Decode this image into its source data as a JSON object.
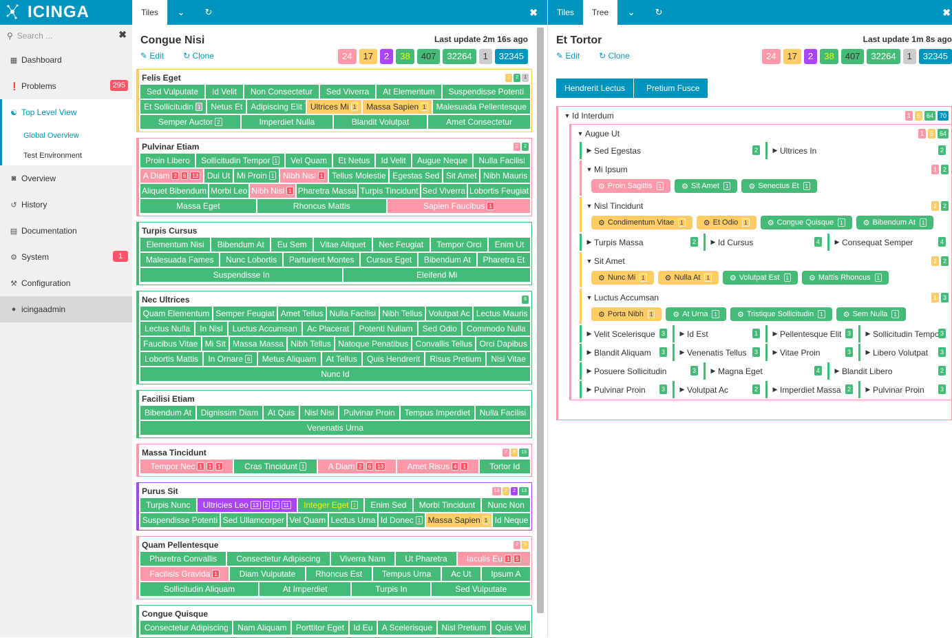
{
  "brand": "icinga",
  "search_placeholder": "Search ...",
  "nav": [
    {
      "label": "Dashboard",
      "icon": "dashboard-icon"
    },
    {
      "label": "Problems",
      "icon": "problems-icon",
      "badge": "295"
    },
    {
      "label": "Top Level View",
      "icon": "sitemap-icon"
    },
    {
      "label": "Global Overview"
    },
    {
      "label": "Test Environment"
    },
    {
      "label": "Overview",
      "icon": "binoculars-icon"
    },
    {
      "label": "History",
      "icon": "history-icon"
    },
    {
      "label": "Documentation",
      "icon": "book-icon"
    },
    {
      "label": "System",
      "icon": "services-icon",
      "badge": "1"
    },
    {
      "label": "Configuration",
      "icon": "wrench-icon"
    },
    {
      "label": "icingaadmin",
      "icon": "user-icon"
    }
  ],
  "left": {
    "tabs": [
      "Tiles"
    ],
    "title": "Congue Nisi",
    "last_update": "Last update 2m 16s ago",
    "edit": "Edit",
    "clone": "Clone",
    "counts": [
      "24",
      "17",
      "2",
      "38",
      "407",
      "32264",
      "1",
      "32345"
    ]
  },
  "right": {
    "tabs": [
      "Tiles",
      "Tree"
    ],
    "title": "Et Tortor",
    "last_update": "Last update 1m 8s ago",
    "edit": "Edit",
    "clone": "Clone",
    "counts": [
      "24",
      "17",
      "2",
      "38",
      "407",
      "32264",
      "1",
      "32345"
    ],
    "crumbs": [
      "Hendrerit Lectus",
      "Pretium Fusce"
    ]
  },
  "colors": {
    "ok": "#44bb77",
    "critical": "#ff99aa",
    "warning": "#ffcc66",
    "unknown": "#aa44ff",
    "accent": "#0095bf"
  },
  "groups": [
    {
      "title": "Felis Eget",
      "counts": [
        "2",
        "2",
        "1"
      ],
      "rows": [
        [
          "Sed Vulputate",
          "Id Velit",
          "Non Consectetur",
          "Sed Viverra",
          "At Elementum",
          "Suspendisse Potenti"
        ],
        [
          "Et Sollicitudin",
          "Netus Et",
          "Adipiscing Elit",
          "Ultrices Mi",
          "Massa Sapien",
          "Malesuada Pellentesque"
        ],
        [
          "Semper Auctor",
          "Imperdiet Nulla",
          "Blandit Volutpat",
          "Amet Consectetur"
        ]
      ]
    },
    {
      "title": "Pulvinar Etiam",
      "counts": [
        "2",
        "2"
      ],
      "rows": [
        [
          "Proin Libero",
          "Sollicitudin Tempor",
          "Vel Quam",
          "Et Netus",
          "Id Velit",
          "Augue Neque",
          "Nulla Facilisi"
        ],
        [
          "A Diam",
          "Dui Ut",
          "Mi Proin",
          "Nibh Nisl",
          "Tellus Molestie",
          "Egestas Sed",
          "Sit Amet",
          "Nibh Mauris"
        ],
        [
          "Aliquet Bibendum",
          "Morbi Leo",
          "Nibh Nisl",
          "Pharetra Massa",
          "Turpis Tincidunt",
          "Sed Viverra",
          "Lobortis Feugiat"
        ],
        [
          "Massa Eget",
          "Rhoncus Mattis",
          "Sapien Faucibus"
        ]
      ]
    },
    {
      "title": "Turpis Cursus",
      "counts": [],
      "rows": [
        [
          "Elementum Nisi",
          "Bibendum At",
          "Eu Sem",
          "Vitae Aliquet",
          "Nec Feugiat",
          "Tempor Orci",
          "Enim Ut"
        ],
        [
          "Malesuada Fames",
          "Nunc Lobortis",
          "Parturient Montes",
          "Cursus Eget",
          "Bibendum At",
          "Pharetra Et"
        ],
        [
          "Suspendisse In",
          "Eleifend Mi"
        ]
      ]
    },
    {
      "title": "Nec Ultrices",
      "counts": [
        "6"
      ],
      "rows": [
        [
          "Quam Elementum",
          "Semper Feugiat",
          "Amet Tellus",
          "Nulla Facilisi",
          "Nibh Tellus",
          "Volutpat Ac",
          "Lectus Mauris"
        ],
        [
          "Lectus Nulla",
          "In Nisl",
          "Luctus Accumsan",
          "Ac Placerat",
          "Potenti Nullam",
          "Sed Odio",
          "Commodo Nulla"
        ],
        [
          "Faucibus Vitae",
          "Mi Sit",
          "Massa Massa",
          "Nibh Tellus",
          "Natoque Penatibus",
          "Convallis Tellus",
          "Orci Dapibus"
        ],
        [
          "Lobortis Mattis",
          "In Ornare",
          "Metus Aliquam",
          "At Tellus",
          "Quis Hendrerit",
          "Risus Pretium",
          "Nisi Vitae"
        ],
        [
          "Nunc Id"
        ]
      ]
    },
    {
      "title": "Facilisi Etiam",
      "counts": [],
      "rows": [
        [
          "Bibendum At",
          "Dignissim Diam",
          "At Quis",
          "Nisl Nisi",
          "Pulvinar Proin",
          "Tempus Imperdiet",
          "Nulla Facilisi"
        ],
        [
          "Venenatis Urna"
        ]
      ]
    },
    {
      "title": "Massa Tincidunt",
      "counts": [
        "7",
        "8",
        "15"
      ],
      "rows": [
        [
          "Tempor Nec",
          "Cras Tincidunt",
          "A Diam",
          "Amet Risus",
          "Tortor Id"
        ]
      ]
    },
    {
      "title": "Purus Sit",
      "counts": [
        "13",
        "2",
        "2",
        "13"
      ],
      "rows": [
        [
          "Turpis Nunc",
          "Ultricies Leo",
          "Integer Eget",
          "Enim Sed",
          "Morbi Tincidunt",
          "Nunc Non"
        ],
        [
          "Suspendisse Potenti",
          "Sed Ullamcorper",
          "Vel Quam",
          "Lectus Urna",
          "Id Donec",
          "Massa Sapien",
          "Id Neque"
        ]
      ]
    },
    {
      "title": "Quam Pellentesque",
      "counts": [
        "2",
        "5"
      ],
      "rows": [
        [
          "Pharetra Convallis",
          "Consectetur Adipiscing",
          "Viverra Nam",
          "Ut Pharetra",
          "Iaculis Eu"
        ],
        [
          "Facilisis Gravida",
          "Diam Vulputate",
          "Rhoncus Est",
          "Tempus Urna",
          "Ac Ut",
          "Ipsum A"
        ],
        [
          "Sollicitudin Aliquam",
          "At Imperdiet",
          "Turpis In",
          "Sed Vulputate"
        ]
      ]
    },
    {
      "title": "Congue Quisque",
      "counts": [],
      "rows": [
        [
          "Consectetur Adipiscing",
          "Nam Aliquam",
          "Porttitor Eget",
          "Id Eu",
          "A Scelerisque",
          "Nisl Pretium",
          "Quis Vel"
        ]
      ]
    }
  ],
  "tree": {
    "root": {
      "label": "Id Interdum",
      "counts": [
        "1",
        "5",
        "64",
        "70"
      ]
    },
    "l1": {
      "label": "Augue Ut",
      "counts": [
        "1",
        "5",
        "64"
      ]
    },
    "nodes": [
      {
        "label": "Sed Egestas",
        "count": "2"
      },
      {
        "label": "Ultrices In",
        "count": "2"
      },
      {
        "label": "Mi Ipsum",
        "counts": [
          "1",
          "2"
        ]
      },
      {
        "label": "Proin Sagittis",
        "b": "1"
      },
      {
        "label": "Sit Amet",
        "b": "1"
      },
      {
        "label": "Senectus Et",
        "b": "1"
      },
      {
        "label": "Nisl Tincidunt",
        "counts": [
          "2",
          "2"
        ]
      },
      {
        "label": "Condimentum Vitae",
        "b": "1"
      },
      {
        "label": "Et Odio",
        "b": "1"
      },
      {
        "label": "Congue Quisque",
        "b": "1"
      },
      {
        "label": "Bibendum At",
        "b": "1"
      },
      {
        "label": "Turpis Massa",
        "count": "2"
      },
      {
        "label": "Id Cursus",
        "count": "4"
      },
      {
        "label": "Consequat Semper",
        "count": "4"
      },
      {
        "label": "Sit Amet",
        "counts": [
          "2",
          "2"
        ]
      },
      {
        "label": "Nunc Mi",
        "b": "1"
      },
      {
        "label": "Nulla At",
        "b": "1"
      },
      {
        "label": "Volutpat Est",
        "b": "1"
      },
      {
        "label": "Mattis Rhoncus",
        "b": "1"
      },
      {
        "label": "Luctus Accumsan",
        "counts": [
          "1",
          "3"
        ]
      },
      {
        "label": "Porta Nibh",
        "b": "1"
      },
      {
        "label": "At Urna",
        "b": "1"
      },
      {
        "label": "Tristique Sollicitudin",
        "b": "1"
      },
      {
        "label": "Sem Nulla",
        "b": "1"
      },
      {
        "label": "Velit Scelerisque",
        "count": "3"
      },
      {
        "label": "Id Est",
        "count": "1"
      },
      {
        "label": "Pellentesque Elit",
        "count": "3"
      },
      {
        "label": "Sollicitudin Tempor",
        "count": "3"
      },
      {
        "label": "Blandit Aliquam",
        "count": "3"
      },
      {
        "label": "Venenatis Tellus",
        "count": "3"
      },
      {
        "label": "Vitae Proin",
        "count": "3"
      },
      {
        "label": "Libero Volutpat",
        "count": "3"
      },
      {
        "label": "Posuere Sollicitudin",
        "count": "3"
      },
      {
        "label": "Magna Eget",
        "count": "4"
      },
      {
        "label": "Blandit Libero",
        "count": "2"
      },
      {
        "label": "Pulvinar Proin",
        "count": "3"
      },
      {
        "label": "Volutpat Ac",
        "count": "2"
      },
      {
        "label": "Imperdiet Massa",
        "count": "2"
      },
      {
        "label": "Pulvinar Proin",
        "count": "3"
      }
    ]
  }
}
